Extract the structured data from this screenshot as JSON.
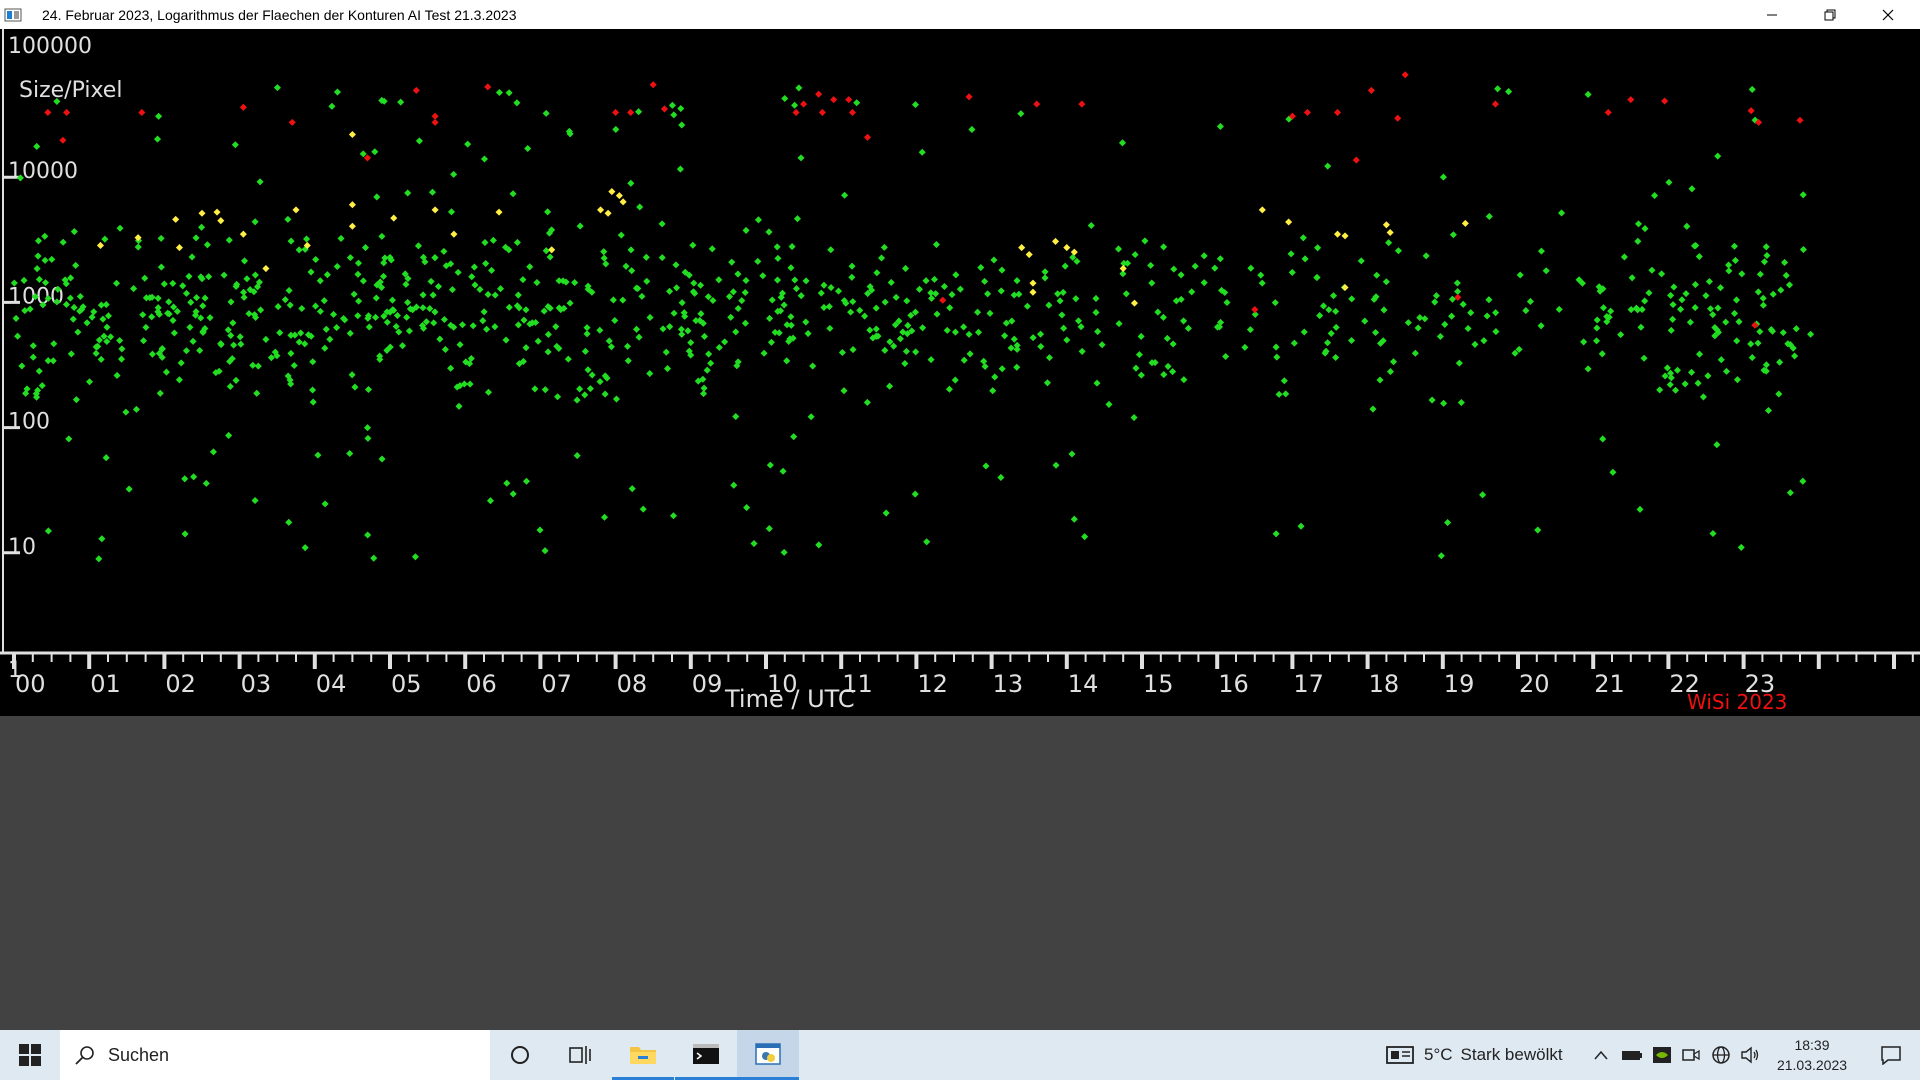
{
  "window": {
    "title": "24. Februar 2023, Logarithmus der Flaechen der Konturen AI Test 21.3.2023",
    "controls": [
      "minimize",
      "restore",
      "close"
    ]
  },
  "colors": {
    "background": "#000000",
    "axis": "#e0e0e0",
    "green": "#22dd22",
    "yellow": "#ffee44",
    "red": "#ee1111",
    "watermark": "#ee1111"
  },
  "chart_data": {
    "type": "scatter",
    "ylabel": "Size/Pixel",
    "xlabel": "Time / UTC",
    "y_scale": "log",
    "ylim": [
      1,
      100000
    ],
    "y_ticks": [
      {
        "label": "100000",
        "value": 100000
      },
      {
        "label": "10000",
        "value": 10000
      },
      {
        "label": "1000",
        "value": 1000
      },
      {
        "label": "100",
        "value": 100
      },
      {
        "label": "10",
        "value": 10
      },
      {
        "label": "1",
        "value": 1
      }
    ],
    "xlim": [
      0,
      25.5
    ],
    "x_ticks": [
      "00",
      "01",
      "02",
      "03",
      "04",
      "05",
      "06",
      "07",
      "08",
      "09",
      "10",
      "11",
      "12",
      "13",
      "14",
      "15",
      "16",
      "17",
      "18",
      "19",
      "20",
      "21",
      "22",
      "23"
    ],
    "watermark": "WiSi 2023",
    "series": [
      {
        "name": "green",
        "color": "#22dd22",
        "count_approx": 1200
      },
      {
        "name": "yellow",
        "color": "#ffee44",
        "count_approx": 50
      },
      {
        "name": "red",
        "color": "#ee1111",
        "count_approx": 45
      }
    ],
    "red_points": [
      [
        0.45,
        30000
      ],
      [
        0.7,
        30000
      ],
      [
        0.65,
        18000
      ],
      [
        1.7,
        30000
      ],
      [
        3.05,
        33000
      ],
      [
        3.7,
        25000
      ],
      [
        4.7,
        13000
      ],
      [
        5.35,
        45000
      ],
      [
        5.6,
        28000
      ],
      [
        5.6,
        25000
      ],
      [
        6.3,
        48000
      ],
      [
        8.0,
        30000
      ],
      [
        8.2,
        30000
      ],
      [
        8.5,
        50000
      ],
      [
        8.65,
        32000
      ],
      [
        10.4,
        30000
      ],
      [
        10.5,
        35000
      ],
      [
        10.7,
        42000
      ],
      [
        10.75,
        30000
      ],
      [
        10.9,
        38000
      ],
      [
        11.1,
        38000
      ],
      [
        11.15,
        30000
      ],
      [
        11.35,
        19000
      ],
      [
        12.7,
        40000
      ],
      [
        13.6,
        35000
      ],
      [
        14.2,
        35000
      ],
      [
        12.35,
        950
      ],
      [
        16.5,
        800
      ],
      [
        17.0,
        28000
      ],
      [
        17.2,
        30000
      ],
      [
        17.6,
        30000
      ],
      [
        17.85,
        12500
      ],
      [
        18.05,
        45000
      ],
      [
        18.4,
        27000
      ],
      [
        18.5,
        60000
      ],
      [
        19.2,
        1000
      ],
      [
        19.7,
        35000
      ],
      [
        21.2,
        30000
      ],
      [
        21.5,
        38000
      ],
      [
        21.95,
        37000
      ],
      [
        23.1,
        31000
      ],
      [
        23.2,
        25000
      ],
      [
        23.75,
        26000
      ],
      [
        23.15,
        600
      ]
    ],
    "yellow_points": [
      [
        1.15,
        2600
      ],
      [
        1.65,
        3000
      ],
      [
        2.15,
        4200
      ],
      [
        2.2,
        2500
      ],
      [
        2.5,
        4700
      ],
      [
        2.7,
        4800
      ],
      [
        2.75,
        4100
      ],
      [
        3.05,
        3200
      ],
      [
        3.35,
        1700
      ],
      [
        3.75,
        5000
      ],
      [
        3.9,
        2600
      ],
      [
        4.5,
        5500
      ],
      [
        4.5,
        3700
      ],
      [
        4.5,
        20000
      ],
      [
        5.05,
        4300
      ],
      [
        5.6,
        5000
      ],
      [
        5.85,
        3200
      ],
      [
        6.45,
        4800
      ],
      [
        7.15,
        2400
      ],
      [
        7.95,
        7000
      ],
      [
        8.05,
        6500
      ],
      [
        8.1,
        5800
      ],
      [
        7.8,
        5000
      ],
      [
        7.9,
        4700
      ],
      [
        13.4,
        2500
      ],
      [
        13.5,
        2200
      ],
      [
        13.55,
        1300
      ],
      [
        13.55,
        1100
      ],
      [
        13.85,
        2800
      ],
      [
        14.0,
        2500
      ],
      [
        14.1,
        2300
      ],
      [
        14.75,
        1700
      ],
      [
        14.9,
        900
      ],
      [
        16.6,
        5000
      ],
      [
        16.95,
        4000
      ],
      [
        17.6,
        3200
      ],
      [
        17.7,
        3100
      ],
      [
        17.7,
        1200
      ],
      [
        18.25,
        3800
      ],
      [
        18.3,
        3300
      ],
      [
        19.3,
        3900
      ]
    ],
    "density_profile_per_hour": [
      55,
      55,
      60,
      55,
      60,
      60,
      55,
      55,
      50,
      45,
      50,
      50,
      35,
      35,
      30,
      25,
      25,
      25,
      25,
      25,
      15,
      35,
      55,
      40,
      5
    ]
  },
  "taskbar": {
    "search_placeholder": "Suchen",
    "weather_temp": "5°C",
    "weather_desc": "Stark bewölkt",
    "time": "18:39",
    "date": "21.03.2023",
    "apps": [
      "cortana-icon",
      "task-view-icon",
      "file-explorer-icon",
      "terminal-icon",
      "python-app-icon"
    ]
  }
}
